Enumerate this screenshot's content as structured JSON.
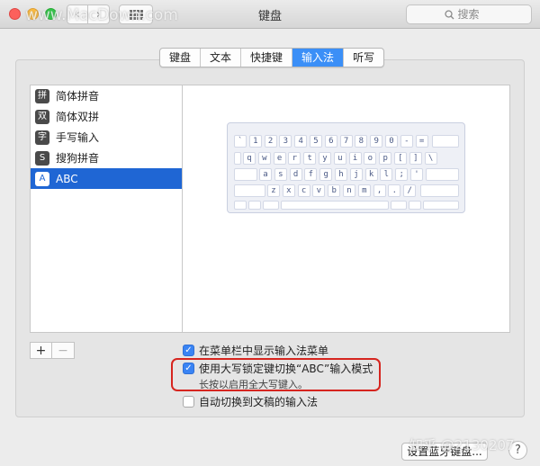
{
  "window": {
    "title": "键盘"
  },
  "toolbar": {
    "back_label": "‹",
    "forward_label": "›",
    "search_placeholder": "搜索"
  },
  "tabs": [
    {
      "label": "键盘",
      "active": false
    },
    {
      "label": "文本",
      "active": false
    },
    {
      "label": "快捷键",
      "active": false
    },
    {
      "label": "输入法",
      "active": true
    },
    {
      "label": "听写",
      "active": false
    }
  ],
  "input_sources": [
    {
      "icon_char": "拼",
      "label": "简体拼音",
      "selected": false
    },
    {
      "icon_char": "双",
      "label": "简体双拼",
      "selected": false
    },
    {
      "icon_char": "字",
      "label": "手写输入",
      "selected": false
    },
    {
      "icon_char": "S",
      "label": "搜狗拼音",
      "selected": false
    },
    {
      "icon_char": "A",
      "label": "ABC",
      "selected": true
    }
  ],
  "keyboard": {
    "row1": [
      "`",
      "1",
      "2",
      "3",
      "4",
      "5",
      "6",
      "7",
      "8",
      "9",
      "0",
      "-",
      "="
    ],
    "row2": [
      "q",
      "w",
      "e",
      "r",
      "t",
      "y",
      "u",
      "i",
      "o",
      "p",
      "[",
      "]",
      "\\"
    ],
    "row3": [
      "a",
      "s",
      "d",
      "f",
      "g",
      "h",
      "j",
      "k",
      "l",
      ";",
      "'"
    ],
    "row4": [
      "z",
      "x",
      "c",
      "v",
      "b",
      "n",
      "m",
      ",",
      ".",
      "/"
    ]
  },
  "list_buttons": {
    "add": "+",
    "remove": "−"
  },
  "options": {
    "show_menu": {
      "label": "在菜单栏中显示输入法菜单",
      "checked": true
    },
    "caps_lock": {
      "label": "使用大写锁定键切换“ABC”输入模式",
      "checked": true,
      "hint": "长按以启用全大写键入。"
    },
    "auto_switch": {
      "label": "自动切换到文稿的输入法",
      "checked": false
    }
  },
  "buttons": {
    "bluetooth": "设置蓝牙键盘...",
    "help": "?"
  },
  "watermarks": {
    "top": "www.MacDown.com",
    "bottom": "知乎 @2130207"
  },
  "colors": {
    "accent": "#3b8ff7",
    "selection": "#1f66d4",
    "highlight": "#d6251f"
  }
}
